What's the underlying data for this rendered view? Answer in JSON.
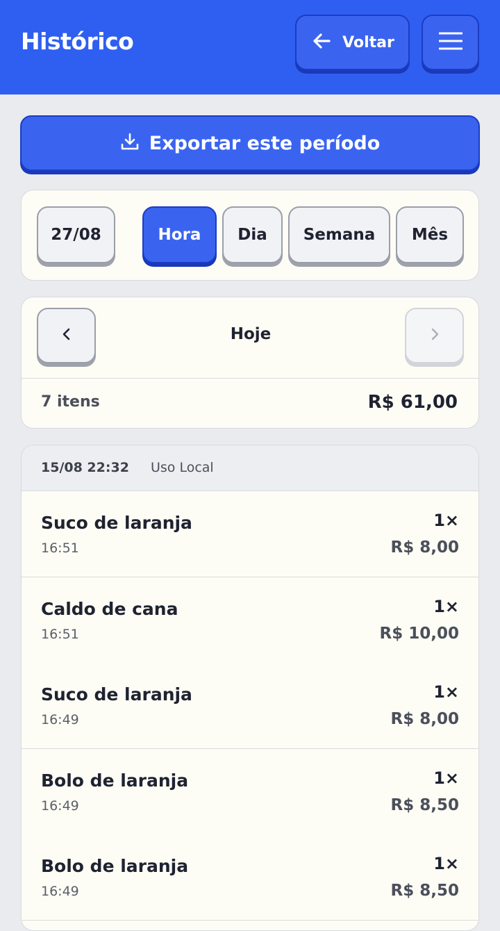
{
  "header": {
    "title": "Histórico",
    "back_label": "Voltar"
  },
  "actions": {
    "export_label": "Exportar este período"
  },
  "filters": {
    "date": "27/08",
    "granularity": [
      {
        "label": "Hora",
        "active": true
      },
      {
        "label": "Dia",
        "active": false
      },
      {
        "label": "Semana",
        "active": false
      },
      {
        "label": "Mês",
        "active": false
      }
    ]
  },
  "period": {
    "label": "Hoje",
    "count": "7 itens",
    "total": "R$ 61,00"
  },
  "order": {
    "datetime": "15/08 22:32",
    "type": "Uso Local",
    "items": [
      {
        "name": "Suco de laranja",
        "time": "16:51",
        "qty": "1×",
        "price": "R$ 8,00"
      },
      {
        "name": "Caldo de cana",
        "time": "16:51",
        "qty": "1×",
        "price": "R$ 10,00"
      },
      {
        "name": "Suco de laranja",
        "time": "16:49",
        "qty": "1×",
        "price": "R$ 8,00"
      },
      {
        "name": "Bolo de laranja",
        "time": "16:49",
        "qty": "1×",
        "price": "R$ 8,50"
      },
      {
        "name": "Bolo de laranja",
        "time": "16:49",
        "qty": "1×",
        "price": "R$ 8,50"
      }
    ]
  }
}
